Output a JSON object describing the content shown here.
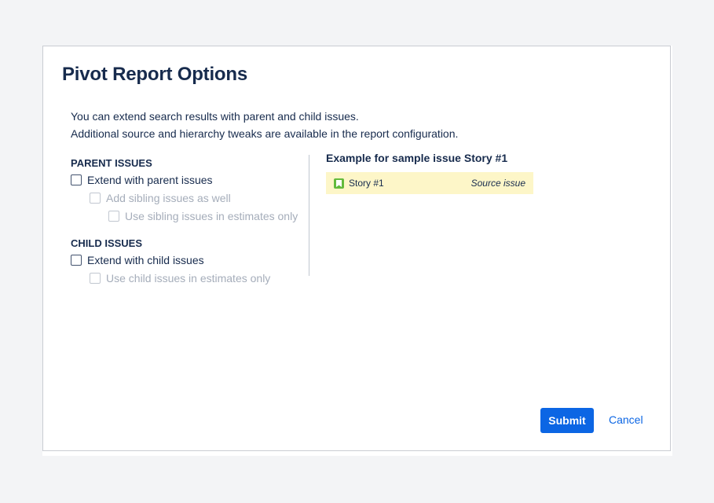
{
  "dialog": {
    "title": "Pivot Report Options",
    "intro_line1": "You can extend search results with parent and child issues.",
    "intro_line2": "Additional source and hierarchy tweaks are available in the report configuration."
  },
  "parent_issues": {
    "heading": "PARENT ISSUES",
    "options": [
      {
        "label": "Extend with parent issues",
        "checked": false,
        "disabled": false
      },
      {
        "label": "Add sibling issues as well",
        "checked": false,
        "disabled": true
      },
      {
        "label": "Use sibling issues in estimates only",
        "checked": false,
        "disabled": true
      }
    ]
  },
  "child_issues": {
    "heading": "CHILD ISSUES",
    "options": [
      {
        "label": "Extend with child issues",
        "checked": false,
        "disabled": false
      },
      {
        "label": "Use child issues in estimates only",
        "checked": false,
        "disabled": true
      }
    ]
  },
  "example": {
    "heading": "Example for sample issue Story #1",
    "issue_key": "Story #1",
    "issue_tag": "Source issue",
    "issue_icon": "story-icon"
  },
  "actions": {
    "submit_label": "Submit",
    "cancel_label": "Cancel"
  },
  "colors": {
    "primary": "#0c66e4",
    "highlight": "#fdf6c8",
    "story_icon": "#63ba3c"
  }
}
